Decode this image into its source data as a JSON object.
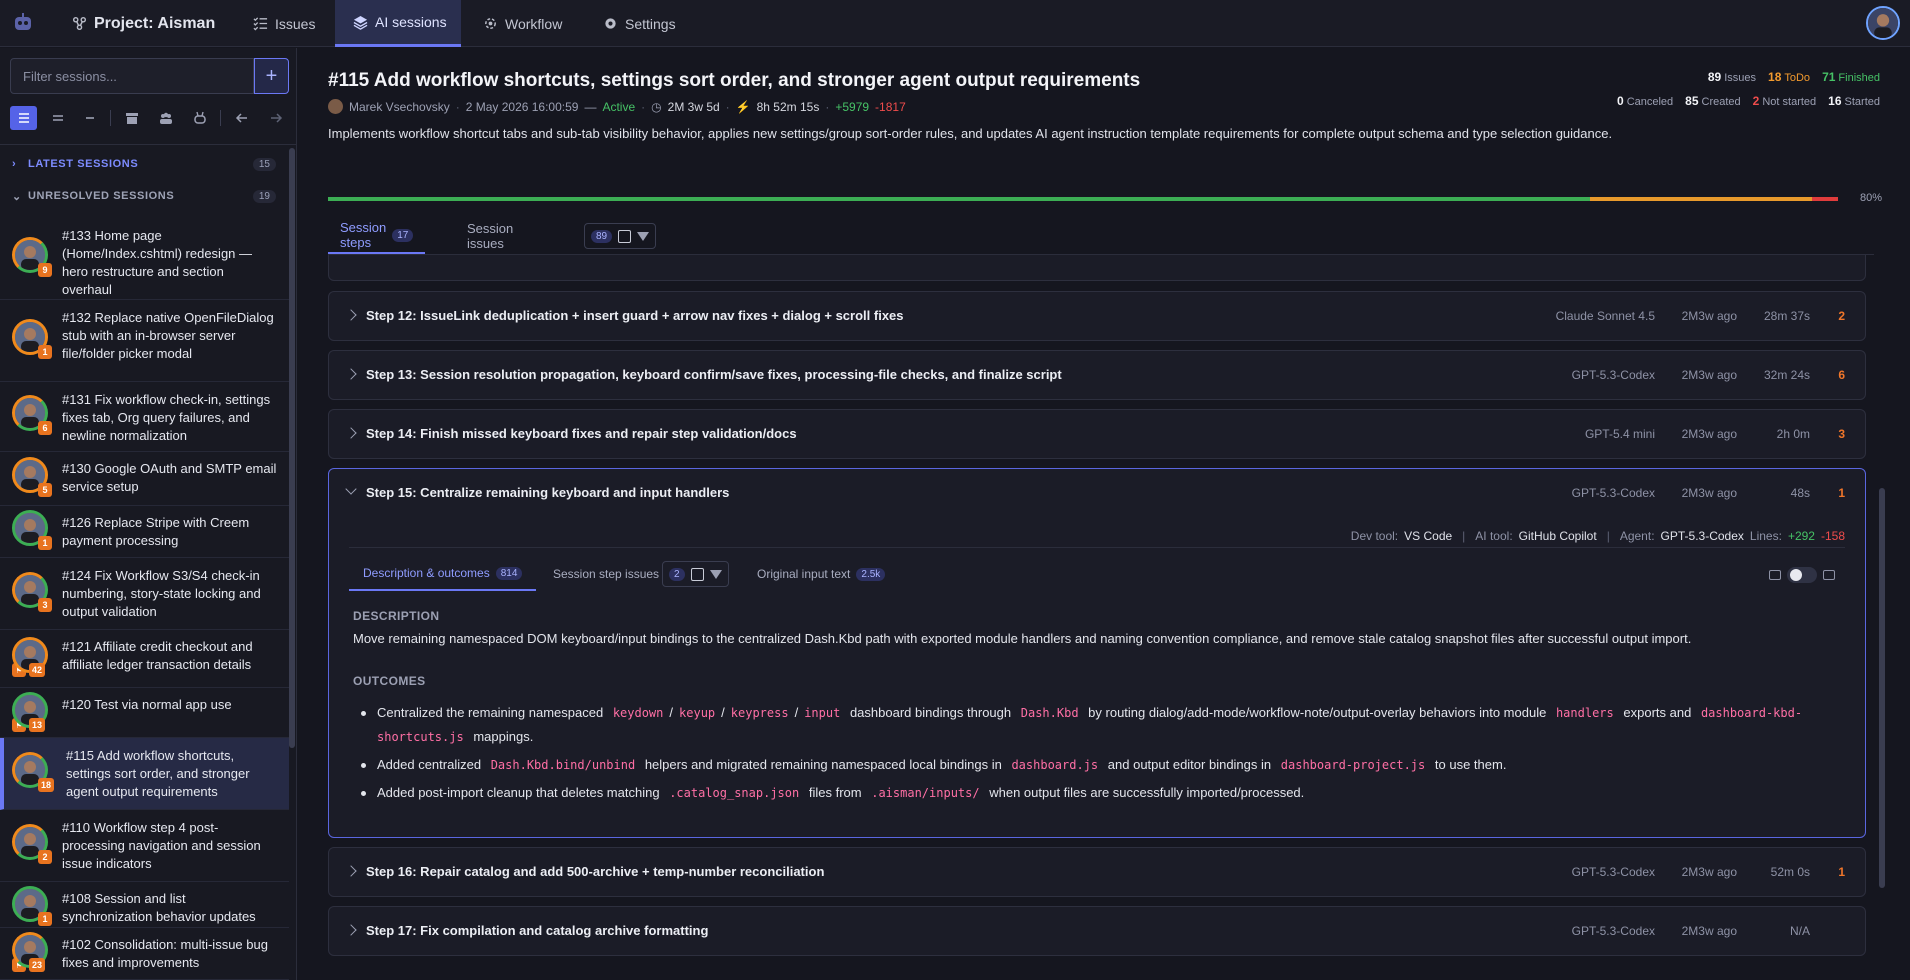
{
  "nav": {
    "project": "Project: Aisman",
    "issues": "Issues",
    "ai_sessions": "AI sessions",
    "workflow": "Workflow",
    "settings": "Settings"
  },
  "sidebar": {
    "filter_placeholder": "Filter sessions...",
    "add_label": "+",
    "latest_label": "LATEST SESSIONS",
    "latest_count": "15",
    "unresolved_label": "UNRESOLVED SESSIONS",
    "unresolved_count": "19",
    "sessions": [
      {
        "title": "#133 Home page (Home/Index.cshtml) redesign — hero restructure and section overhaul",
        "badge": "9"
      },
      {
        "title": "#132 Replace native OpenFileDialog stub with an in-browser server file/folder picker modal",
        "badge": "1"
      },
      {
        "title": "#131 Fix workflow check-in, settings fixes tab, Org query failures, and newline normalization",
        "badge": "6"
      },
      {
        "title": "#130 Google OAuth and SMTP email service setup",
        "badge": "5"
      },
      {
        "title": "#126 Replace Stripe with Creem payment processing",
        "badge": "1"
      },
      {
        "title": "#124 Fix Workflow S3/S4 check-in numbering, story-state locking and output validation",
        "badge": "3"
      },
      {
        "title": "#121 Affiliate credit checkout and affiliate ledger transaction details",
        "badge": "42"
      },
      {
        "title": "#120 Test via normal app use",
        "badge": "13"
      },
      {
        "title": "#115 Add workflow shortcuts, settings sort order, and stronger agent output requirements",
        "badge": "18"
      },
      {
        "title": "#110 Workflow step 4 post-processing navigation and session issue indicators",
        "badge": "2"
      },
      {
        "title": "#108 Session and list synchronization behavior updates",
        "badge": "1"
      },
      {
        "title": "#102 Consolidation: multi-issue bug fixes and improvements",
        "badge": "23"
      }
    ]
  },
  "header": {
    "title": "#115 Add workflow shortcuts, settings sort order, and stronger agent output requirements",
    "author": "Marek Vsechovsky",
    "date": "2 May 2026 16:00:59",
    "dash": "—",
    "status": "Active",
    "elapsed": "2M 3w 5d",
    "work_time": "8h 52m 15s",
    "added": "+5979",
    "removed": "-1817",
    "description": "Implements workflow shortcut tabs and sub-tab visibility behavior, applies new settings/group sort-order rules, and updates AI agent instruction template requirements for complete output schema and type selection guidance."
  },
  "stats": {
    "issues": "89",
    "issues_label": "Issues",
    "todo": "18",
    "todo_label": "ToDo",
    "finished": "71",
    "finished_label": "Finished",
    "canceled": "0",
    "canceled_label": "Canceled",
    "created": "85",
    "created_label": "Created",
    "not_started": "2",
    "not_started_label": "Not started",
    "started": "16",
    "started_label": "Started"
  },
  "progress": {
    "label": "80%",
    "green_fraction": 0.8,
    "orange_fraction": 0.147,
    "red_fraction": 0.017
  },
  "tabs": {
    "session_steps": "Session steps",
    "session_steps_count": "17",
    "session_issues": "Session issues",
    "session_issues_count": "89"
  },
  "steps": [
    {
      "title": "Step 12: IssueLink deduplication + insert guard + arrow nav fixes + dialog + scroll fixes",
      "model": "Claude Sonnet 4.5",
      "ago": "2M3w ago",
      "duration": "28m 37s",
      "count": "2"
    },
    {
      "title": "Step 13: Session resolution propagation, keyboard confirm/save fixes, processing-file checks, and finalize script",
      "model": "GPT-5.3-Codex",
      "ago": "2M3w ago",
      "duration": "32m 24s",
      "count": "6"
    },
    {
      "title": "Step 14: Finish missed keyboard fixes and repair step validation/docs",
      "model": "GPT-5.4 mini",
      "ago": "2M3w ago",
      "duration": "2h 0m",
      "count": "3"
    },
    {
      "title": "Step 15: Centralize remaining keyboard and input handlers",
      "model": "GPT-5.3-Codex",
      "ago": "2M3w ago",
      "duration": "48s",
      "count": "1"
    },
    {
      "title": "Step 16: Repair catalog and add 500-archive + temp-number reconciliation",
      "model": "GPT-5.3-Codex",
      "ago": "2M3w ago",
      "duration": "52m 0s",
      "count": "1"
    },
    {
      "title": "Step 17: Fix compilation and catalog archive formatting",
      "model": "GPT-5.3-Codex",
      "ago": "2M3w ago",
      "duration": "N/A",
      "count": ""
    }
  ],
  "expanded": {
    "dev_tool_label": "Dev tool:",
    "dev_tool": "VS Code",
    "ai_tool_label": "AI tool:",
    "ai_tool": "GitHub Copilot",
    "agent_label": "Agent:",
    "agent": "GPT-5.3-Codex",
    "lines_label": "Lines:",
    "lines_added": "+292",
    "lines_removed": "-158",
    "tab_desc": "Description & outcomes",
    "tab_desc_count": "814",
    "tab_issues": "Session step issues",
    "tab_issues_count": "2",
    "tab_input": "Original input text",
    "tab_input_count": "2.5k",
    "description_heading": "DESCRIPTION",
    "description": "Move remaining namespaced DOM keyboard/input bindings to the centralized Dash.Kbd path with exported module handlers and naming convention compliance, and remove stale catalog snapshot files after successful output import.",
    "outcomes_heading": "OUTCOMES",
    "o1_a": "Centralized the remaining namespaced",
    "o1_c1": "keydown",
    "o1_s1": "/",
    "o1_c2": "keyup",
    "o1_s2": "/",
    "o1_c3": "keypress",
    "o1_s3": "/",
    "o1_c4": "input",
    "o1_b": "dashboard bindings through",
    "o1_c5": "Dash.Kbd",
    "o1_c": "by routing dialog/add-mode/workflow-note/output-overlay behaviors into module",
    "o1_c6": "handlers",
    "o1_d": "exports and",
    "o1_c7": "dashboard-kbd-shortcuts.js",
    "o1_e": "mappings.",
    "o2_a": "Added centralized",
    "o2_c1": "Dash.Kbd.bind/unbind",
    "o2_b": "helpers and migrated remaining namespaced local bindings in",
    "o2_c2": "dashboard.js",
    "o2_c": "and output editor bindings in",
    "o2_c3": "dashboard-project.js",
    "o2_d": "to use them.",
    "o3_a": "Added post-import cleanup that deletes matching",
    "o3_c1": ".catalog_snap.json",
    "o3_b": "files from",
    "o3_c2": ".aisman/inputs/",
    "o3_c": "when output files are successfully imported/processed."
  }
}
